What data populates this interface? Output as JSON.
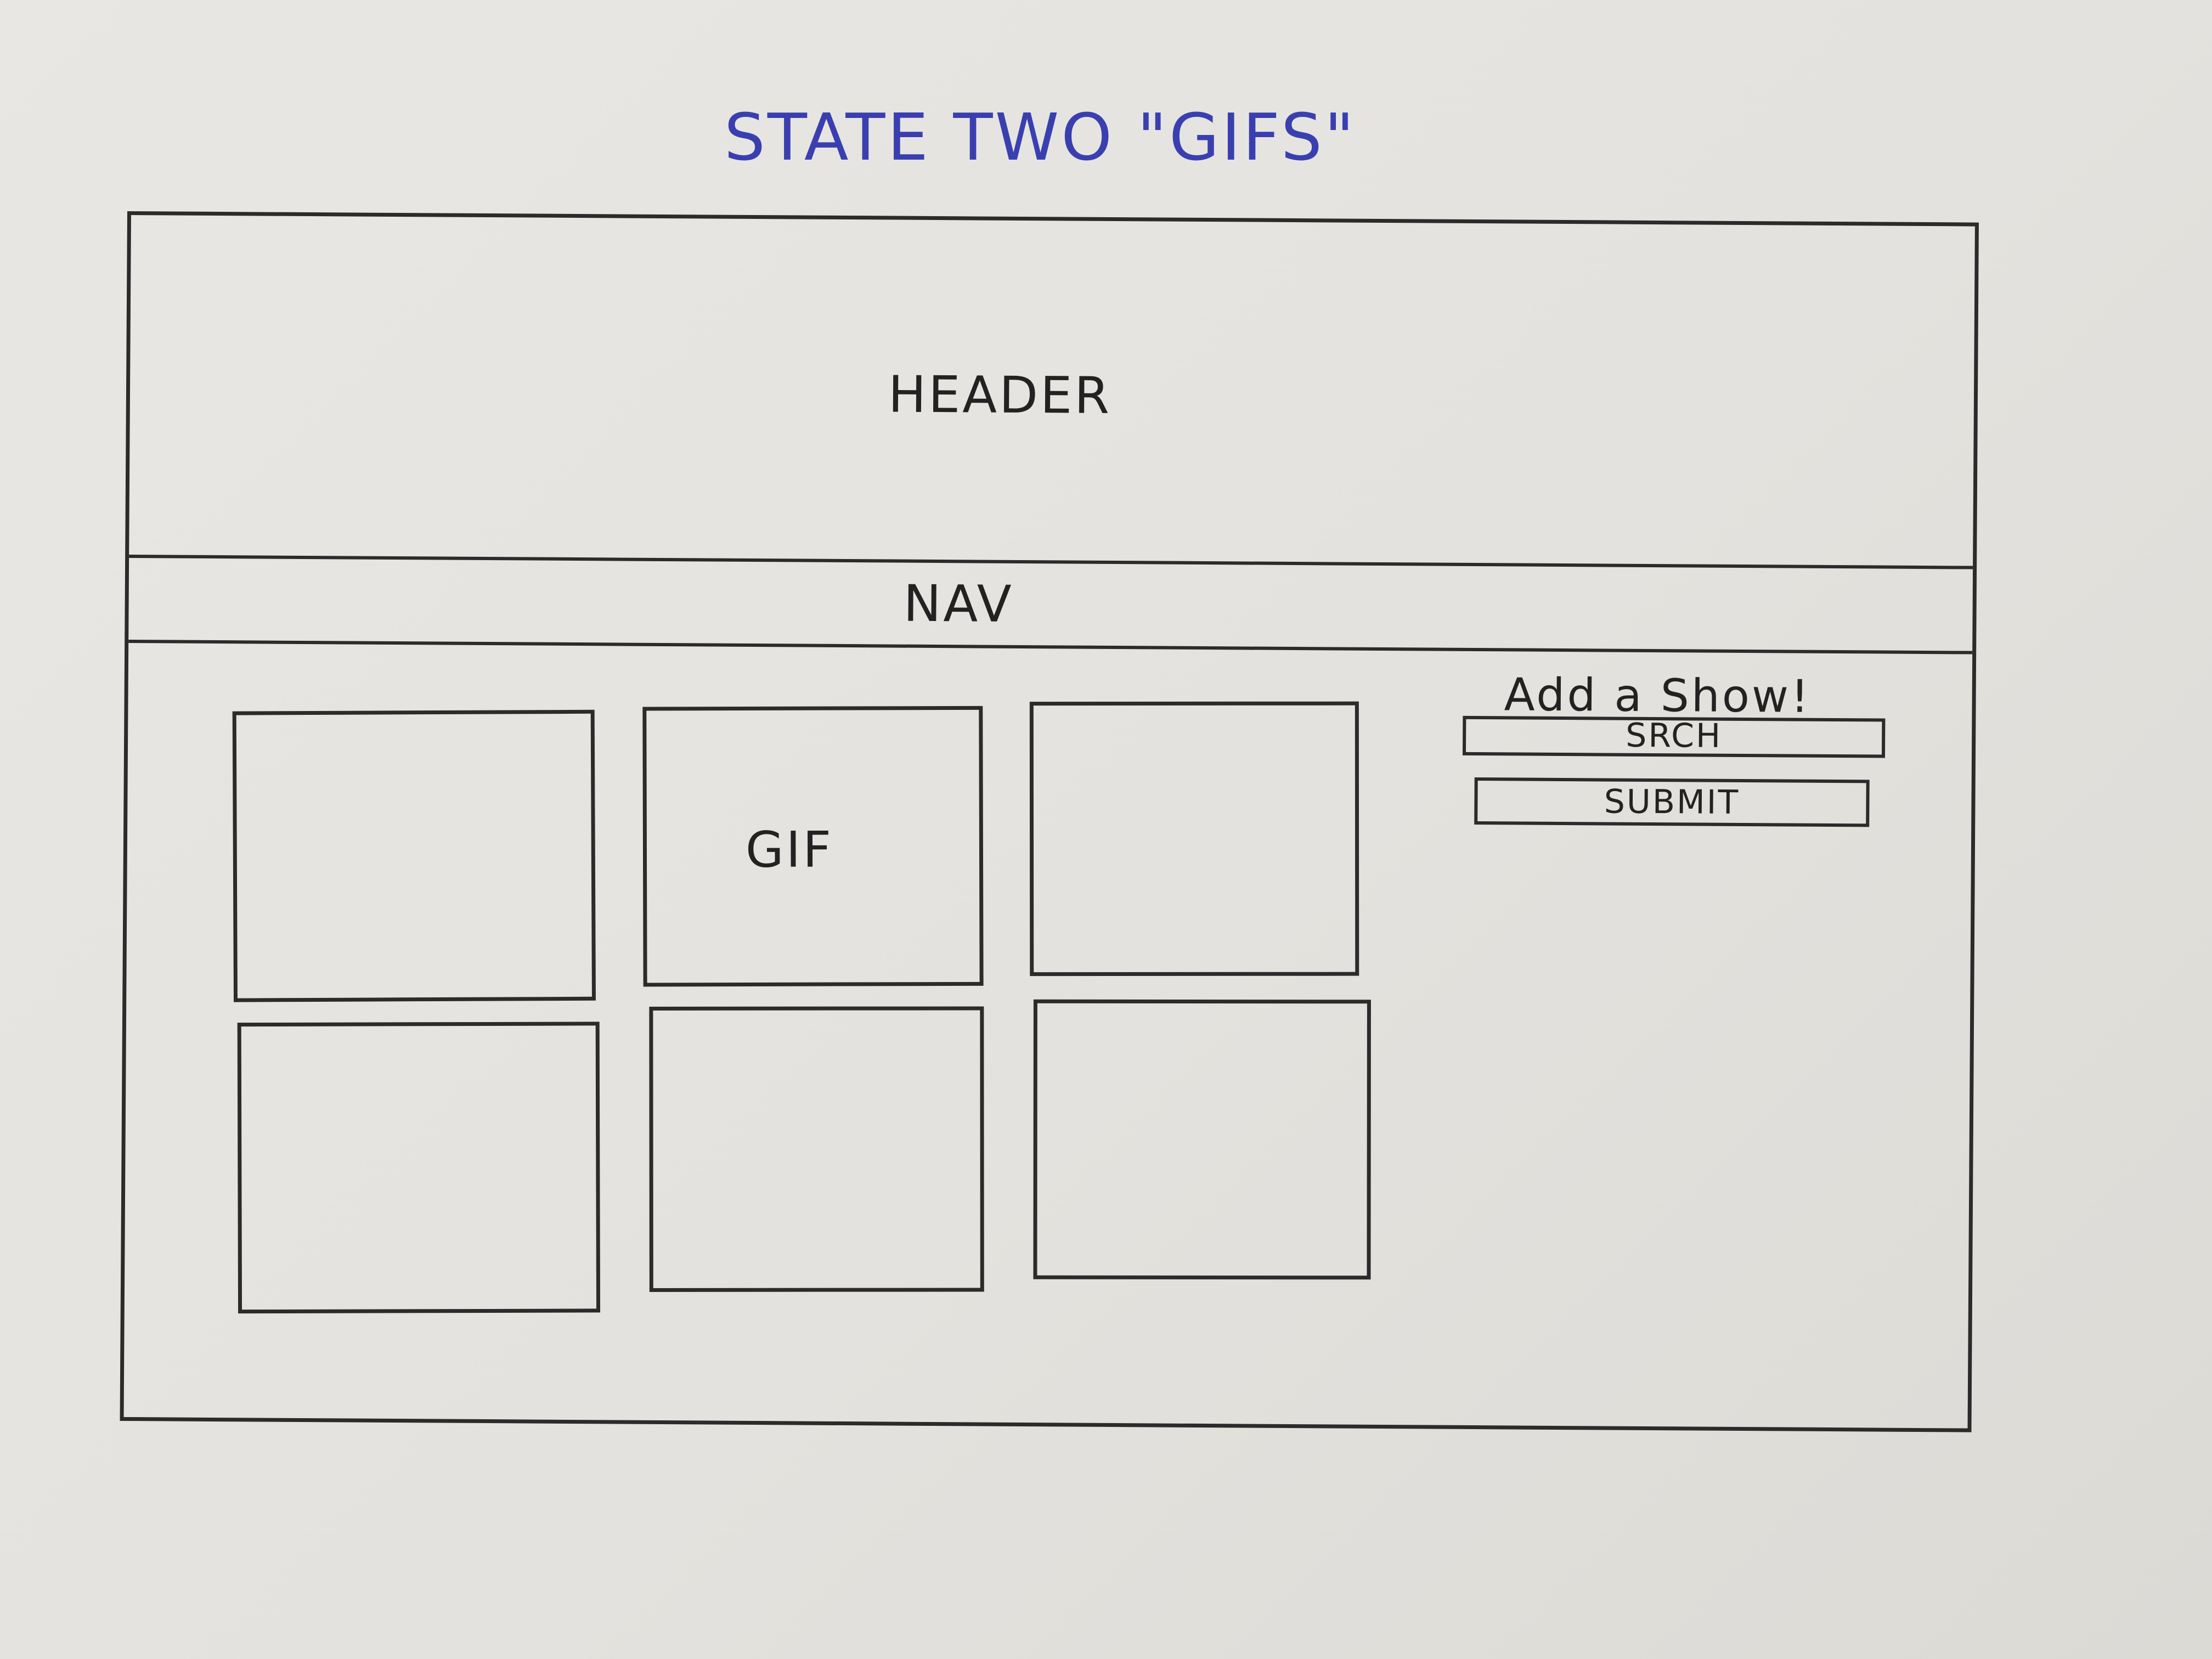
{
  "title": "STATE TWO \"GIFS\"",
  "colors": {
    "title_ink": "#3a3fb0",
    "pencil_ink": "#2b2b2b",
    "paper": "#e6e4e0"
  },
  "wireframe": {
    "header_label": "HEADER",
    "nav_label": "NAV",
    "gif_grid": {
      "rows": 2,
      "columns": 3,
      "items": [
        {
          "label": ""
        },
        {
          "label": "GIF"
        },
        {
          "label": ""
        },
        {
          "label": ""
        },
        {
          "label": ""
        },
        {
          "label": ""
        }
      ]
    },
    "sidebar": {
      "title": "Add a Show!",
      "search_label": "SRCH",
      "submit_label": "SUBMIT"
    }
  }
}
